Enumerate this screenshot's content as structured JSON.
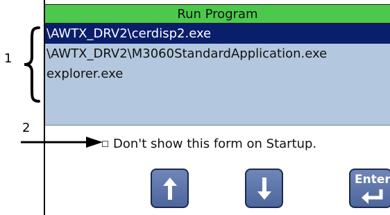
{
  "window": {
    "title": "Run Program"
  },
  "program_list": {
    "items": [
      {
        "label": "\\AWTX_DRV2\\cerdisp2.exe",
        "selected": true
      },
      {
        "label": "\\AWTX_DRV2\\M3060StandardApplication.exe",
        "selected": false
      },
      {
        "label": "explorer.exe",
        "selected": false
      }
    ]
  },
  "startup_option": {
    "label": "Don't show this form on Startup.",
    "checked": false
  },
  "buttons": {
    "up_icon": "arrow-up-icon",
    "down_icon": "arrow-down-icon",
    "enter_label": "Enter"
  },
  "callouts": {
    "list": "1",
    "checkbox": "2"
  },
  "colors": {
    "title_bar": "#4cc94c",
    "list_background": "#b3c8de",
    "selection": "#0a1f6b",
    "button": "#5b73a8"
  }
}
